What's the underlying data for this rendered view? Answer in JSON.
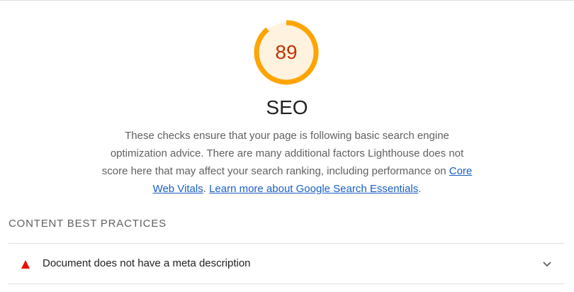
{
  "score": {
    "value": "89",
    "fraction": 0.89,
    "color": "#ffa400",
    "bg_color": "#fff3e0",
    "text_color": "#c33300"
  },
  "category": {
    "title": "SEO",
    "description_text": "These checks ensure that your page is following basic search engine optimization advice. There are many additional factors Lighthouse does not score here that may affect your search ranking, including performance on",
    "link_core_web_vitals": "Core Web Vitals",
    "separator": ".",
    "link_learn_more": "Learn more about Google Search Essentials",
    "end_punct": "."
  },
  "groups": [
    {
      "title": "CONTENT BEST PRACTICES",
      "audits": [
        {
          "title": "Document does not have a meta description",
          "status": "fail",
          "status_icon": "red-triangle-icon",
          "status_color": "#eb0f00",
          "expand_icon": "chevron-down-icon"
        }
      ]
    }
  ]
}
